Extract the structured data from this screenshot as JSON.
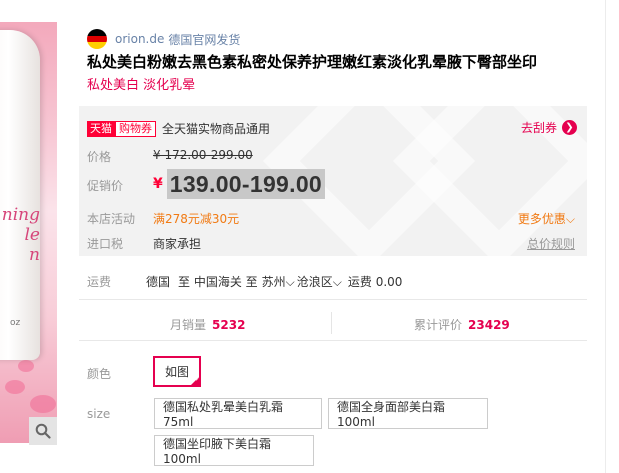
{
  "gallery": {
    "product_text": "ning\nle\nn",
    "size_text": "oz",
    "search_icon": "search-icon"
  },
  "shop": {
    "flag": "germany-flag",
    "name": "orion.de",
    "sub": "德国官网发货"
  },
  "product": {
    "title": "私处美白粉嫩去黑色素私密处保养护理嫩红素淡化乳晕腋下臀部坐印",
    "subtitle": "私处美白 淡化乳晕"
  },
  "price_panel": {
    "badge_tmall": "天猫",
    "badge_coupon": "购物券",
    "coupon_text": "全天猫实物商品通用",
    "get_coupon": "去刮券",
    "price_label": "价格",
    "old_price": "¥ 172.00-299.00",
    "promo_label": "促销价",
    "promo_currency": "¥",
    "promo_price": "139.00-199.00",
    "activity_label": "本店活动",
    "activity": "满278元减30元",
    "more_offers": "更多优惠",
    "tax_label": "进口税",
    "tax": "商家承担",
    "tax_rule": "总价规则"
  },
  "shipping": {
    "label": "运费",
    "from": "德国",
    "to": "至 中国海关 至",
    "city": "苏州",
    "district": "沧浪区",
    "fee": "运费 0.00"
  },
  "stats": {
    "monthly_label": "月销量",
    "monthly": "5232",
    "reviews_label": "累计评价",
    "reviews": "23429"
  },
  "sku": {
    "color_label": "颜色",
    "color_options": [
      "如图"
    ],
    "size_label": "size",
    "size_options": [
      "德国私处乳晕美白乳霜75ml",
      "德国全身面部美白霜100ml",
      "德国坐印腋下美白霜100ml"
    ]
  },
  "colors": {
    "accent": "#e5004f",
    "tmall_red": "#ff0036",
    "promo_orange": "#f17a13",
    "link_blue": "#6882a7"
  }
}
